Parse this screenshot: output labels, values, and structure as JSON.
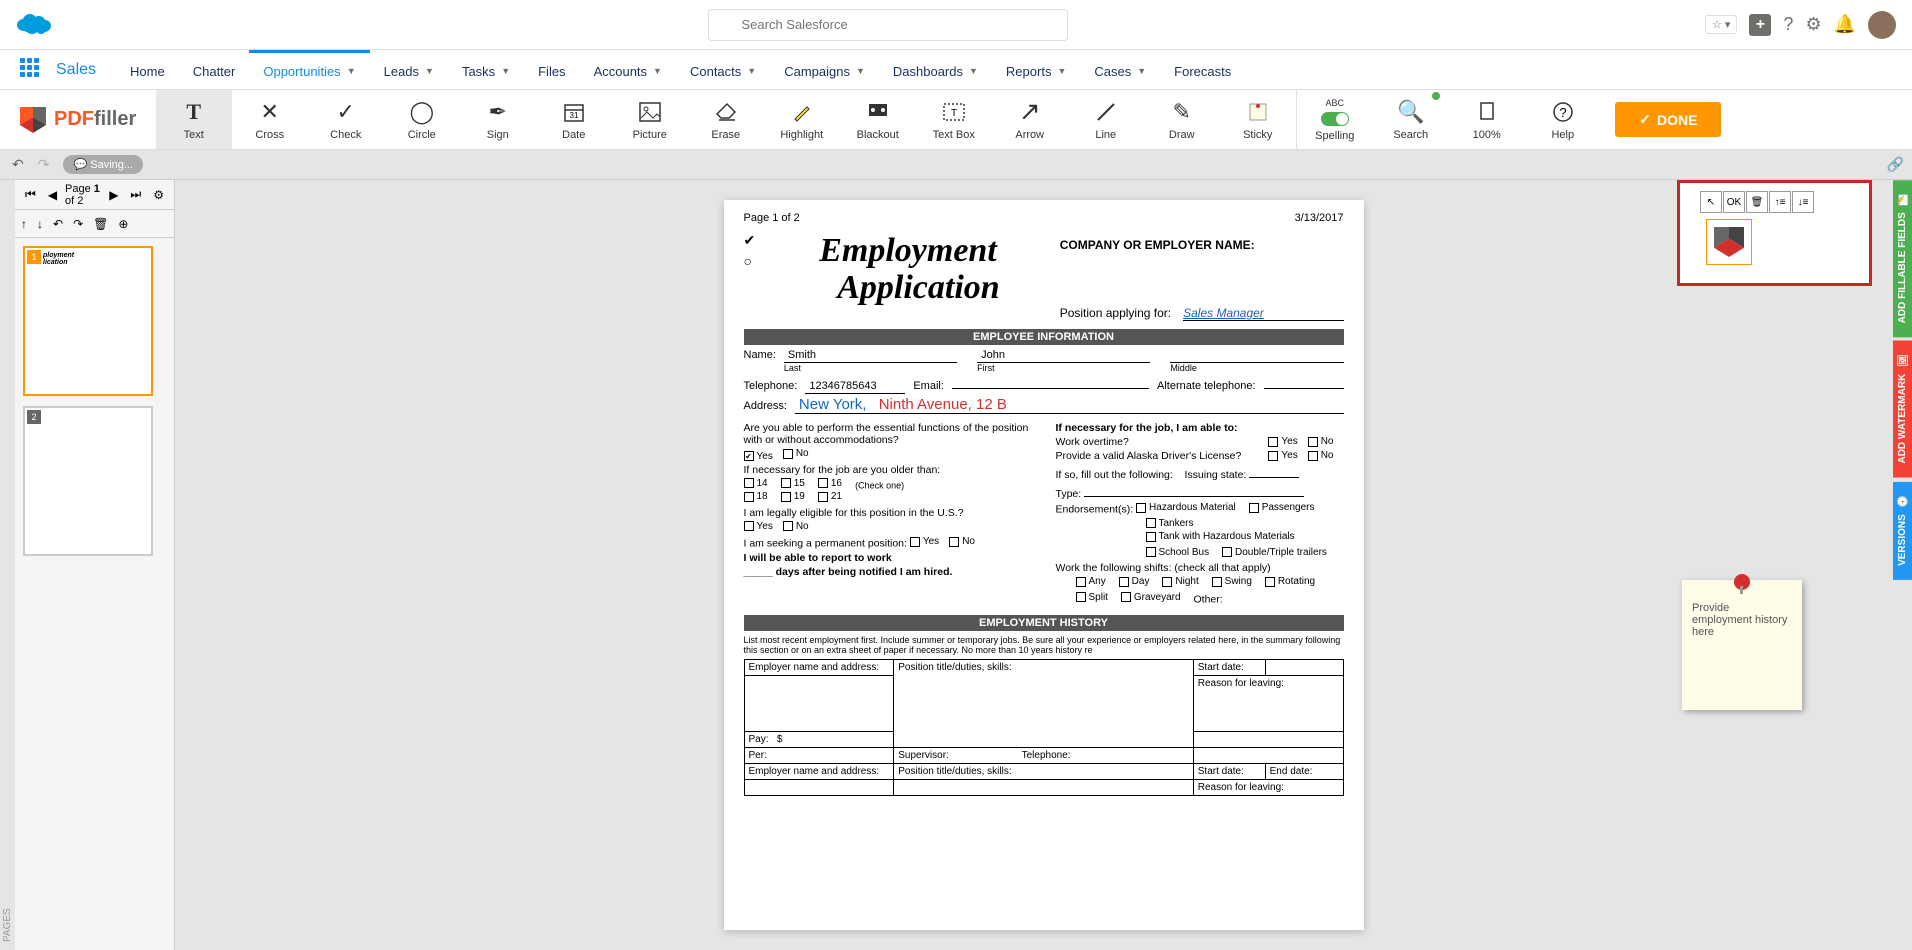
{
  "salesforce": {
    "search_placeholder": "Search Salesforce",
    "app_label": "Sales",
    "nav": [
      "Home",
      "Chatter",
      "Opportunities",
      "Leads",
      "Tasks",
      "Files",
      "Accounts",
      "Contacts",
      "Campaigns",
      "Dashboards",
      "Reports",
      "Cases",
      "Forecasts"
    ],
    "nav_active_index": 2
  },
  "pdffiller_logo": {
    "part1": "PDF",
    "part2": "filler"
  },
  "tools": [
    {
      "label": "Text",
      "icon": "T",
      "active": true
    },
    {
      "label": "Cross",
      "icon": "✕"
    },
    {
      "label": "Check",
      "icon": "✓"
    },
    {
      "label": "Circle",
      "icon": "◯"
    },
    {
      "label": "Sign",
      "icon": "✒"
    },
    {
      "label": "Date",
      "icon": "📅"
    },
    {
      "label": "Picture",
      "icon": "🖼"
    },
    {
      "label": "Erase",
      "icon": "⌫"
    },
    {
      "label": "Highlight",
      "icon": "🖍"
    },
    {
      "label": "Blackout",
      "icon": "■"
    },
    {
      "label": "Text Box",
      "icon": "⬚"
    },
    {
      "label": "Arrow",
      "icon": "↗"
    },
    {
      "label": "Line",
      "icon": "—"
    },
    {
      "label": "Draw",
      "icon": "✎"
    },
    {
      "label": "Sticky",
      "icon": "📌"
    }
  ],
  "right_tools": [
    {
      "label": "Spelling",
      "sub": "ABC"
    },
    {
      "label": "Search"
    },
    {
      "label": "100%"
    },
    {
      "label": "Help"
    }
  ],
  "done_btn": "DONE",
  "status": {
    "saving": "Saving..."
  },
  "page_indicator": {
    "prefix": "Page ",
    "value": "1",
    "suffix": " of 2"
  },
  "thumbnails": {
    "count": 2,
    "active": 1
  },
  "document": {
    "page_label": "Page 1 of 2",
    "date": "3/13/2017",
    "title_line1": "Employment",
    "title_line2": "Application",
    "company_label": "COMPANY OR EMPLOYER NAME:",
    "position_label": "Position applying for:",
    "position_value": "Sales Manager",
    "section_employee": "EMPLOYEE INFORMATION",
    "fields": {
      "name_label": "Name:",
      "last": "Smith",
      "last_label": "Last",
      "first": "John",
      "first_label": "First",
      "middle_label": "Middle",
      "phone_label": "Telephone:",
      "phone": "12346785643",
      "email_label": "Email:",
      "alt_phone_label": "Alternate telephone:",
      "address_label": "Address:",
      "city": "New York,",
      "street": "Ninth Avenue, 12 B"
    },
    "questions": {
      "q1": "Are you able to perform the essential functions of the position with or without accommodations?",
      "yes": "Yes",
      "no": "No",
      "q2": "If necessary for the job are you older than:",
      "ages": [
        "14",
        "15",
        "16",
        "18",
        "19",
        "21"
      ],
      "check_one": "(Check one)",
      "q3": "I am legally eligible for this position in the U.S.?",
      "q4": "I am seeking a permanent position:",
      "q5a": "I will be able to report to work",
      "q5b": "_____ days after being notified I am hired.",
      "r1": "If necessary for the job, I am able to:",
      "r1a": "Work overtime?",
      "r1b": "Provide a valid Alaska Driver's License?",
      "r1c": "If so, fill out the following:",
      "issuing": "Issuing state:",
      "type": "Type:",
      "endorse": "Endorsement(s):",
      "end_opts": [
        "Hazardous Material",
        "Passengers",
        "Tankers",
        "Tank with Hazardous Materials",
        "School Bus",
        "Double/Triple trailers"
      ],
      "shifts": "Work the following shifts: (check all that apply)",
      "shift_opts": [
        "Any",
        "Day",
        "Night",
        "Swing",
        "Rotating",
        "Split",
        "Graveyard"
      ],
      "other": "Other:"
    },
    "section_history": "EMPLOYMENT HISTORY",
    "history_intro": "List most recent employment first. Include summer or temporary jobs. Be sure all your experience or employers related here, in the summary following this section or on an extra sheet of paper if necessary. No more than 10 years history re",
    "table_headers": {
      "employer": "Employer name and address:",
      "position": "Position title/duties, skills:",
      "start": "Start date:",
      "end": "End date:",
      "reason": "Reason for leaving:",
      "pay": "Pay:",
      "pay_sym": "$",
      "per": "Per:",
      "supervisor": "Supervisor:",
      "telephone": "Telephone:"
    }
  },
  "annotation": {
    "ok": "OK"
  },
  "sticky": {
    "text": "Provide employment history here"
  },
  "side_tabs": {
    "fillable": "ADD FILLABLE FIELDS",
    "watermark": "ADD WATERMARK",
    "versions": "VERSIONS"
  },
  "pages_label": "PAGES"
}
